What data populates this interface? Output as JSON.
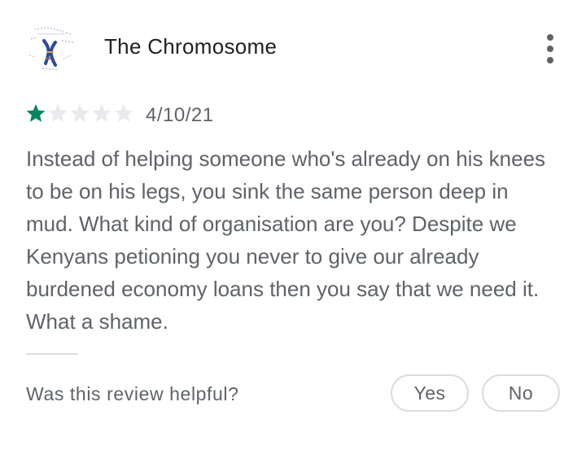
{
  "review": {
    "author_name": "The Chromosome",
    "avatar_icon": "chromosome-avatar-icon",
    "more_icon": "more-vertical-icon",
    "rating": 1,
    "rating_max": 5,
    "date": "4/10/21",
    "text": "Instead of helping someone who's already on his knees to be on his legs, you sink the same person deep in mud. What kind of organisation are you? Despite we Kenyans petioning you never to give our already burdened economy loans then you say that we need it. What a shame."
  },
  "feedback": {
    "question": "Was this review helpful?",
    "yes_label": "Yes",
    "no_label": "No"
  },
  "colors": {
    "star_filled": "#01875f",
    "star_empty": "#e8eaed",
    "secondary_text": "#5f6368",
    "primary_text": "#202124",
    "border": "#dadce0"
  }
}
